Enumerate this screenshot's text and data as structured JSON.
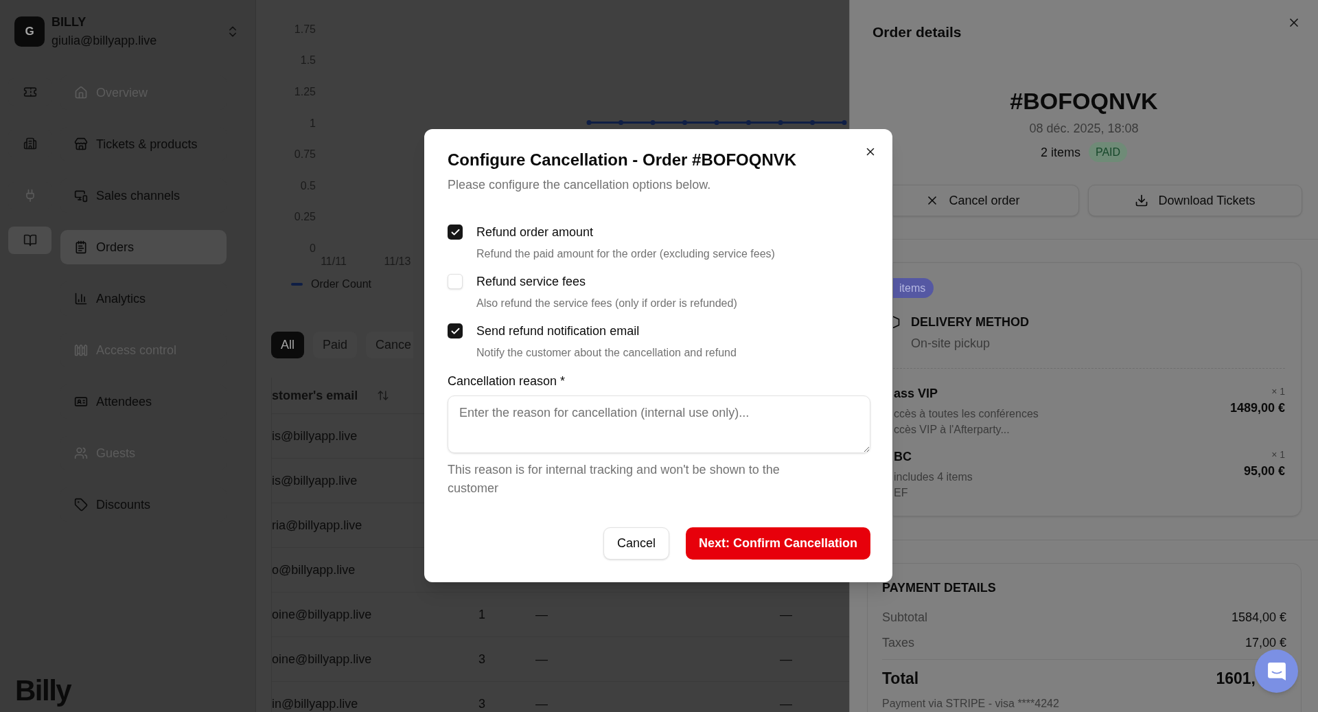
{
  "sidebar": {
    "account": {
      "avatar": "G",
      "name": "BILLY",
      "email": "giulia@billyapp.live"
    },
    "rail": [
      {
        "selected": false,
        "disabled": false
      },
      {
        "selected": false,
        "disabled": false
      },
      {
        "selected": false,
        "disabled": true
      },
      {
        "selected": true,
        "disabled": false
      }
    ],
    "nav": [
      {
        "label": "Overview",
        "selected": false,
        "disabled": true
      },
      {
        "label": "Tickets & products",
        "selected": false,
        "disabled": false
      },
      {
        "label": "Sales channels",
        "selected": false,
        "disabled": false
      },
      {
        "label": "Orders",
        "selected": true,
        "disabled": false
      },
      {
        "label": "Analytics",
        "selected": false,
        "disabled": false
      },
      {
        "label": "Access control",
        "selected": false,
        "disabled": true
      },
      {
        "label": "Attendees",
        "selected": false,
        "disabled": false
      },
      {
        "label": "Guests",
        "selected": false,
        "disabled": true
      },
      {
        "label": "Discounts",
        "selected": false,
        "disabled": false
      }
    ],
    "logo": "Billy"
  },
  "main": {
    "chart": {
      "chart_data": {
        "type": "line",
        "categories": [
          "11/11",
          null,
          "11/13",
          null,
          null,
          null,
          null,
          null,
          null,
          null,
          null,
          null,
          null,
          null,
          null,
          null,
          null
        ],
        "ylim": [
          0,
          1.75
        ],
        "yticks": [
          0,
          0.25,
          0.5,
          0.75,
          1,
          1.25,
          1.5,
          1.75
        ],
        "series": [
          {
            "name": "Order Count",
            "color": "#0f1e45",
            "marker": true,
            "values": [
              null,
              null,
              null,
              null,
              null,
              null,
              null,
              null,
              1,
              1,
              1,
              1,
              1,
              1,
              1,
              1,
              1
            ]
          }
        ]
      }
    },
    "filters": [
      {
        "label": "All",
        "selected": true
      },
      {
        "label": "Paid",
        "selected": false
      },
      {
        "label": "Cance",
        "selected": false
      }
    ],
    "table": {
      "columns": [
        {
          "label": "stomer's email"
        }
      ],
      "rows": [
        {
          "cells": [
            "is@billyapp.live"
          ]
        },
        {
          "cells": [
            "is@billyapp.live"
          ]
        },
        {
          "cells": [
            "ria@billyapp.live"
          ]
        },
        {
          "cells": [
            "o@billyapp.live"
          ]
        },
        {
          "cells": [
            "oine@billyapp.live",
            "1",
            "—",
            "—"
          ]
        },
        {
          "cells": [
            "oine@billyapp.live",
            "3",
            "—",
            "—"
          ]
        },
        {
          "cells": [
            "in@billyapp.live",
            "3",
            "—",
            "—"
          ]
        }
      ]
    }
  },
  "drawer": {
    "title": "Order details",
    "order_number": "#BOFOQNVK",
    "date": "08 déc. 2025, 18:08",
    "items_count": "2 items",
    "status": "PAID",
    "actions": [
      {
        "label": "Cancel order"
      },
      {
        "label": "Download Tickets"
      }
    ],
    "delivery": {
      "items_badge": "items",
      "heading": "DELIVERY METHOD",
      "method": "On-site pickup",
      "products": [
        {
          "name": "ass VIP",
          "quantity": "× 1",
          "price": "1489,00 €",
          "details": [
            "ccès à toutes les conférences",
            "ccès VIP à l'Afterparty..."
          ]
        },
        {
          "name": "BC",
          "quantity": "× 1",
          "price": "95,00 €",
          "details": [
            "includes 4 items",
            "EF"
          ]
        }
      ]
    },
    "payment": {
      "heading": "PAYMENT DETAILS",
      "lines": [
        {
          "label": "Subtotal",
          "value": "1584,00 €"
        },
        {
          "label": "Taxes",
          "value": "17,00 €"
        }
      ],
      "total_label": "Total",
      "total_value": "1601,",
      "note": "Payment via STRIPE - visa ****4242"
    }
  },
  "modal": {
    "title": "Configure Cancellation - Order #BOFOQNVK",
    "subtitle": "Please configure the cancellation options below.",
    "options": [
      {
        "label": "Refund order amount",
        "description": "Refund the paid amount for the order (excluding service fees)",
        "checked": true
      },
      {
        "label": "Refund service fees",
        "description": "Also refund the service fees (only if order is refunded)",
        "checked": false
      },
      {
        "label": "Send refund notification email",
        "description": "Notify the customer about the cancellation and refund",
        "checked": true
      }
    ],
    "reason": {
      "label": "Cancellation reason *",
      "placeholder": "Enter the reason for cancellation (internal use only)...",
      "help": "This reason is for internal tracking and won't be shown to the customer"
    },
    "buttons": [
      {
        "label": "Cancel",
        "kind": "secondary"
      },
      {
        "label": "Next: Confirm Cancellation",
        "kind": "primary"
      }
    ]
  }
}
